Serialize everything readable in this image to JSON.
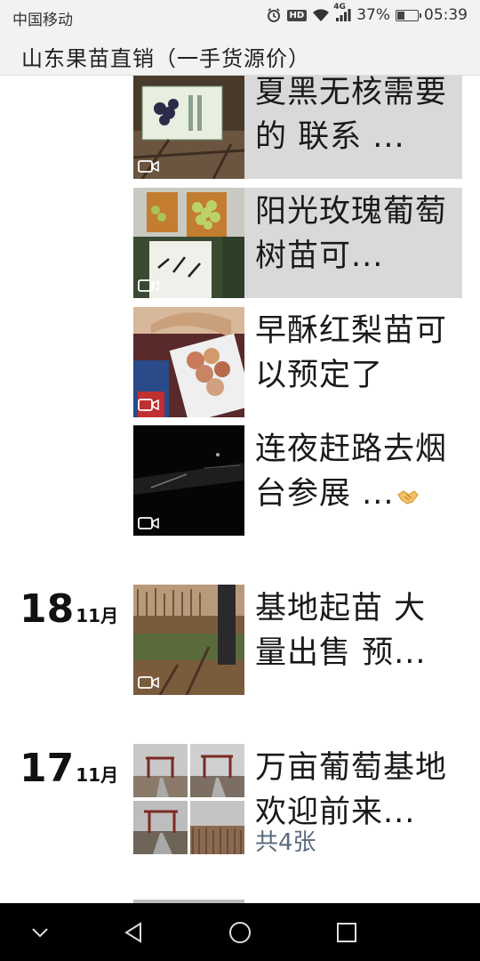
{
  "status_bar": {
    "carrier": "中国移动",
    "network": "4G",
    "battery": "37%",
    "battery_level": 0.37,
    "time": "05:39",
    "icons": [
      "alarm-icon",
      "hd-icon",
      "wifi-icon",
      "signal-icon",
      "battery-icon"
    ]
  },
  "header": {
    "title": "山东果苗直销（一手货源价）"
  },
  "feed": {
    "entries": [
      {
        "text": "夏黑无核需要的 联系 ...",
        "has_video": true
      },
      {
        "text": "阳光玫瑰葡萄 树苗可...",
        "has_video": true
      },
      {
        "text": "早酥红梨苗可以预定了",
        "has_video": true
      },
      {
        "text": "连夜赶路去烟台参展 ...",
        "has_video": true,
        "emoji": "handshake-emoji"
      },
      {
        "day": "18",
        "month": "11月",
        "text": "基地起苗 大量出售 预...",
        "has_video": true
      },
      {
        "day": "17",
        "month": "11月",
        "text": "万亩葡萄基地 欢迎前来...",
        "count": "共4张"
      }
    ]
  },
  "nav_bar": {
    "buttons": [
      "collapse-icon",
      "back-icon",
      "home-icon",
      "recents-icon"
    ]
  }
}
